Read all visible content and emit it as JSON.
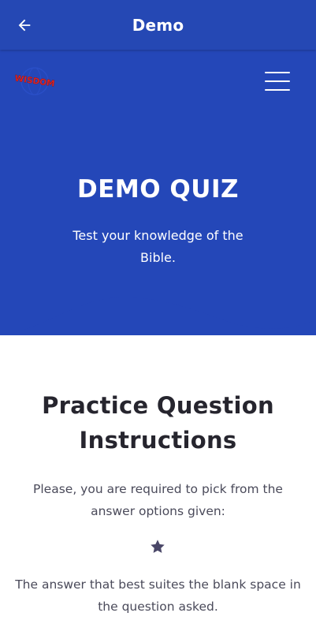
{
  "appbar": {
    "title": "Demo",
    "back_icon": "arrow-left-icon"
  },
  "header": {
    "logo_text": "WISDOM",
    "menu_icon": "hamburger-menu-icon"
  },
  "hero": {
    "title": "DEMO QUIZ",
    "subtitle": "Test your knowledge of the Bible."
  },
  "content": {
    "section_title": "Practice Question Instructions",
    "instruction": "Please, you are required to pick from the answer options given:",
    "bullet_icon": "star-icon",
    "answer_rule": "The answer that best suites the blank space in the question asked."
  },
  "colors": {
    "appbar": "#2548b4",
    "hero": "#2447b8",
    "logo_red": "#e02424",
    "title_dark": "#26252e",
    "body_text": "#4a4a5a",
    "star": "#4a4768"
  }
}
